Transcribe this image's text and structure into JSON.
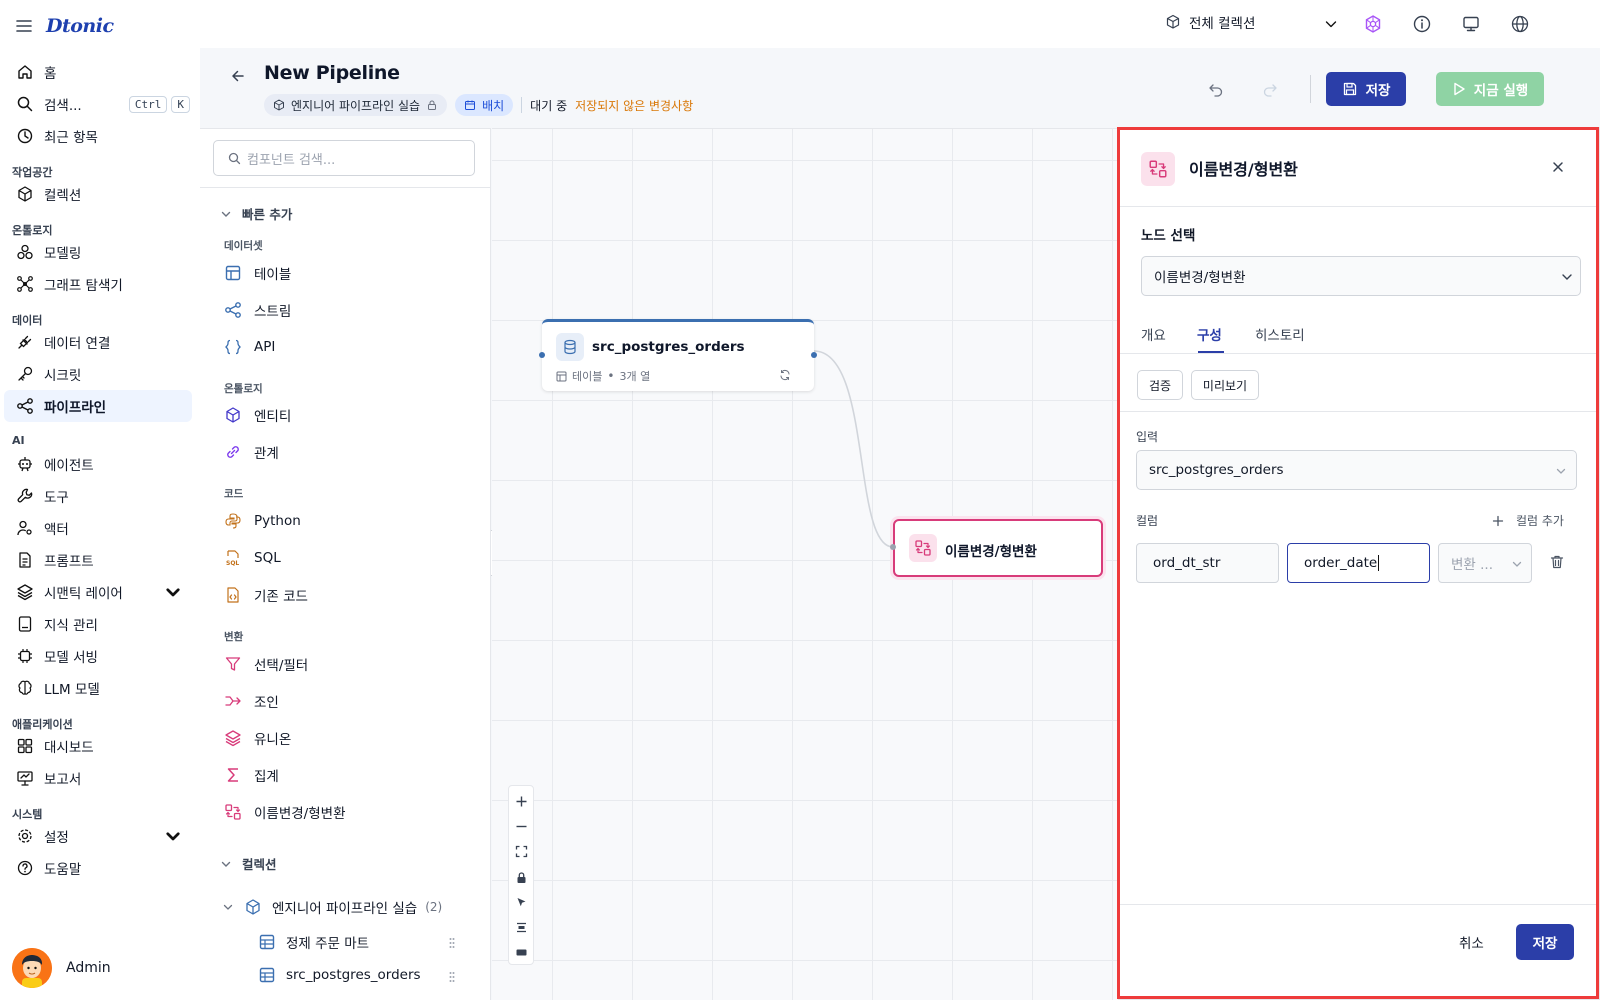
{
  "app": {
    "logo": "Dtonic"
  },
  "sidebar": {
    "home": "홈",
    "search": "검색...",
    "search_kbd": [
      "Ctrl",
      "K"
    ],
    "recent": "최근 항목",
    "groups": {
      "workspace": "작업공간",
      "ontology": "온톨로지",
      "data": "데이터",
      "ai": "AI",
      "app": "애플리케이션",
      "system": "시스템"
    },
    "items": {
      "collection": "컬렉션",
      "modeling": "모델링",
      "graph_explorer": "그래프 탐색기",
      "data_connection": "데이터 연결",
      "secret": "시크릿",
      "pipeline": "파이프라인",
      "agent": "에이전트",
      "tool": "도구",
      "actor": "액터",
      "prompt": "프롬프트",
      "semantic_layer": "시맨틱 레이어",
      "knowledge": "지식 관리",
      "model_serving": "모델 서빙",
      "llm_model": "LLM 모델",
      "dashboard": "대시보드",
      "report": "보고서",
      "settings": "설정",
      "help": "도움말"
    },
    "user": "Admin"
  },
  "topbar": {
    "collection_selector": "전체 컬렉션"
  },
  "pipeline": {
    "title": "New Pipeline",
    "collection_chip": "엔지니어 파이프라인 실습",
    "mode_chip": "배치",
    "status": "대기 중",
    "unsaved": "저장되지 않은 변경사항",
    "save_label": "저장",
    "run_label": "지금 실행"
  },
  "components": {
    "search_placeholder": "컴포넌트 검색...",
    "quick_add": "빠른 추가",
    "cat_dataset": "데이터셋",
    "table": "테이블",
    "stream": "스트림",
    "api": "API",
    "cat_ontology": "온톨로지",
    "entity": "엔티티",
    "relation": "관계",
    "cat_code": "코드",
    "python": "Python",
    "sql": "SQL",
    "base_code": "기존 코드",
    "cat_transform": "변환",
    "select_filter": "선택/필터",
    "join": "조인",
    "union": "유니온",
    "aggregate": "집계",
    "rename_cast": "이름변경/형변환",
    "collection_section": "컬렉션",
    "collection_name": "엔지니어 파이프라인 실습",
    "collection_count": "(2)",
    "coll_items": [
      "정제 주문 마트",
      "src_postgres_orders"
    ]
  },
  "canvas": {
    "node_source": {
      "title": "src_postgres_orders",
      "type": "테이블",
      "cols": "3개 열"
    },
    "node_rename": {
      "title": "이름변경/형변환"
    }
  },
  "panel": {
    "title": "이름변경/형변환",
    "node_select_label": "노드 선택",
    "node_select_value": "이름변경/형변환",
    "tabs": [
      "개요",
      "구성",
      "히스토리"
    ],
    "active_tab": "구성",
    "validate": "검증",
    "preview": "미리보기",
    "input_label": "입력",
    "input_value": "src_postgres_orders",
    "columns_label": "컬럼",
    "add_column": "컬럼 추가",
    "column_row": {
      "source": "ord_dt_str",
      "target": "order_date",
      "type_placeholder": "변환 ..."
    },
    "cancel": "취소",
    "save": "저장"
  },
  "colors": {
    "primary": "#2b3ea8",
    "run_disabled": "#8fd3a4",
    "unsaved": "#d97706",
    "rename_accent": "#d83b7a",
    "highlight_frame": "#ee3b3b"
  }
}
